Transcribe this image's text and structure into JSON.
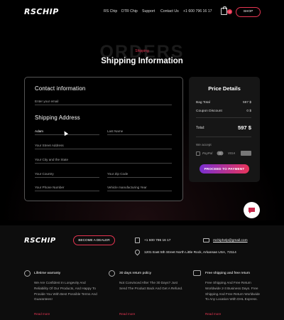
{
  "header": {
    "logo": "RSCHIP",
    "nav": [
      "RS Chip",
      "DTR Chip",
      "Support",
      "Contact Us",
      "+1 600 796 16 17"
    ],
    "cart_count": "0",
    "shop_label": "SHOP"
  },
  "hero": {
    "ghost_text": "ORDERS",
    "breadcrumb": "Shipping",
    "title": "Shipping Information"
  },
  "form": {
    "contact_title": "Contact information",
    "email_placeholder": "Enter your email",
    "shipping_title": "Shipping Address",
    "first_name": "Adam",
    "last_name_placeholder": "Last Name",
    "street_placeholder": "Your Street Address",
    "city_placeholder": "Your City and the State",
    "country_placeholder": "Your Country",
    "zip_placeholder": "Your Zip Code",
    "phone_placeholder": "Your Phone Number",
    "year_placeholder": "Vehicle manufacturing Year"
  },
  "price": {
    "title": "Price Details",
    "bag_label": "Bag Total",
    "bag_value": "597 $",
    "coupon_label": "Coupon Discount",
    "coupon_value": "0 $",
    "total_label": "Total:",
    "total_value": "597 $",
    "accept_label": "We accept",
    "payment_icons": [
      "pay-icon",
      "paypal-icon",
      "mastercard-icon",
      "visa-icon",
      "amex-icon"
    ],
    "pay_button": "PROCEED TO PAYMENT"
  },
  "footer": {
    "logo": "RSCHIP",
    "dealer_button": "BECOME A DEALER",
    "phone": "+1 600 796 16 17",
    "email": "rschiphelp@gmail.com",
    "address": "1201 East 5th Street North Little Rock, Arkansas USA, 72114",
    "features": [
      {
        "title": "Lifetime warranty",
        "text": "We Are Confident In Longevity And Reliability Of Our Products, And Happy To Provide You With Best Possible Terms And Guarantees!",
        "more": "Read more"
      },
      {
        "title": "30 days return policy",
        "text": "Not Convinced After The 30 Days? Just Send The Product Back And Get A Refund.",
        "more": "Read more"
      },
      {
        "title": "Free shipping and free return",
        "text": "Free Shipping And Free Return Worldwide 2-3 Business Days. Free Shipping And Free Return Worldwide To Any Location With DHL Express.",
        "more": "Read more"
      }
    ]
  },
  "colors": {
    "accent": "#e63552",
    "gradient_start": "#7a2fd1",
    "gradient_end": "#e8345a"
  }
}
